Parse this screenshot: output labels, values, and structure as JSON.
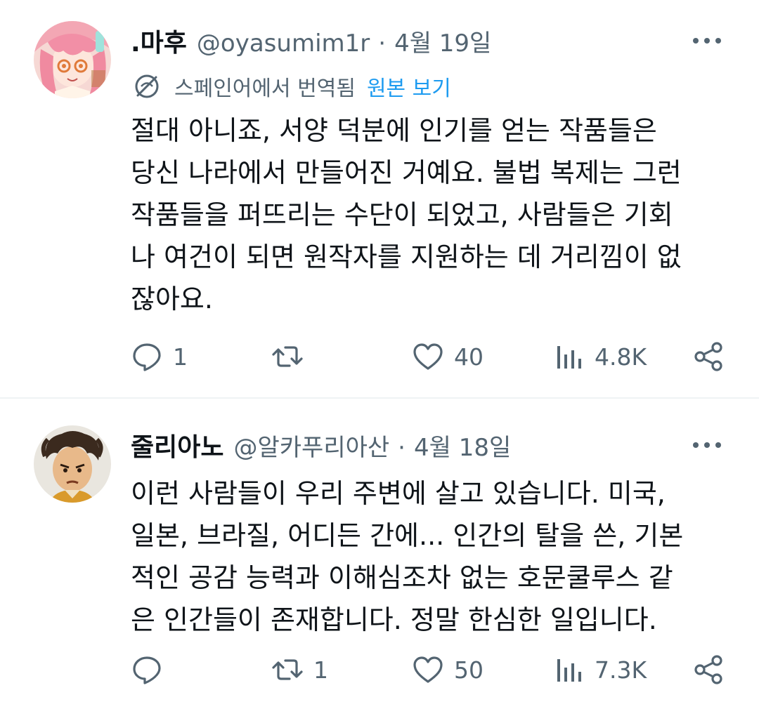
{
  "tweets": [
    {
      "author": {
        "display_name": ".마후",
        "handle": "@oyasumim1r",
        "avatar": "pink-haired-anime-girl-avatar"
      },
      "separator": "·",
      "date": "4월 19일",
      "translation": {
        "label": "스페인어에서 번역됨",
        "link": "원본 보기",
        "icon": "globe-translate-icon"
      },
      "text": "절대 아니죠, 서양 덕분에 인기를 얻는 작품들은\n당신 나라에서 만들어진 거예요. 불법 복제는 그런\n작품들을 퍼뜨리는 수단이 되었고, 사람들은 기회\n나 여건이 되면 원작자를 지원하는 데 거리낌이 없\n잖아요.",
      "stats": {
        "replies": "1",
        "retweets": "",
        "likes": "40",
        "views": "4.8K"
      }
    },
    {
      "author": {
        "display_name": "줄리아노",
        "handle": "@알카푸리아산",
        "avatar": "cartoon-boy-avatar"
      },
      "separator": "·",
      "date": "4월 18일",
      "text": "이런 사람들이 우리 주변에 살고 있습니다. 미국,\n일본, 브라질, 어디든 간에... 인간의 탈을 쓴, 기본\n적인 공감 능력과 이해심조차 없는 호문쿨루스 같\n은 인간들이 존재합니다. 정말 한심한 일입니다.",
      "stats": {
        "replies": "",
        "retweets": "1",
        "likes": "50",
        "views": "7.3K"
      }
    }
  ],
  "colors": {
    "text_primary": "#0f1419",
    "text_secondary": "#536471",
    "link": "#1d9bf0",
    "divider": "#eff3f4"
  },
  "icons": [
    "more-icon",
    "reply-icon",
    "retweet-icon",
    "like-icon",
    "views-icon",
    "share-icon"
  ]
}
